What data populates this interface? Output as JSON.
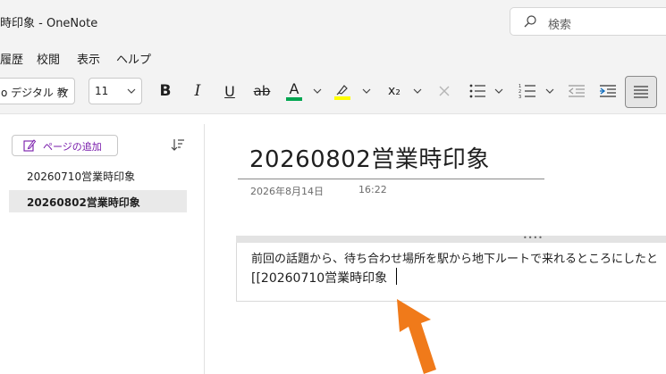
{
  "window": {
    "title": "時印象 - OneNote",
    "search_placeholder": "検索"
  },
  "menu": [
    "履歴",
    "校閲",
    "表示",
    "ヘルプ"
  ],
  "ribbon": {
    "font_name": "o デジタル 教",
    "font_size": "11",
    "bold_label": "B",
    "italic_label": "I",
    "underline_label": "U",
    "strike_label": "ab",
    "font_color_label": "A",
    "font_color": "#00a651",
    "highlight_color": "#ffff00",
    "subscript_label": "x₂"
  },
  "sidebar": {
    "add_page_label": "ページの追加",
    "pages": [
      {
        "label": "20260710営業時印象",
        "selected": false
      },
      {
        "label": "20260802営業時印象",
        "selected": true
      }
    ]
  },
  "page": {
    "title": "20260802営業時印象",
    "date": "2026年8月14日",
    "time": "16:22",
    "line1": "前回の話題から、待ち合わせ場所を駅から地下ルートで来れるところにしたと",
    "line2": "[[20260710営業時印象"
  },
  "colors": {
    "accent": "#7719aa",
    "arrow": "#f07a1a"
  }
}
